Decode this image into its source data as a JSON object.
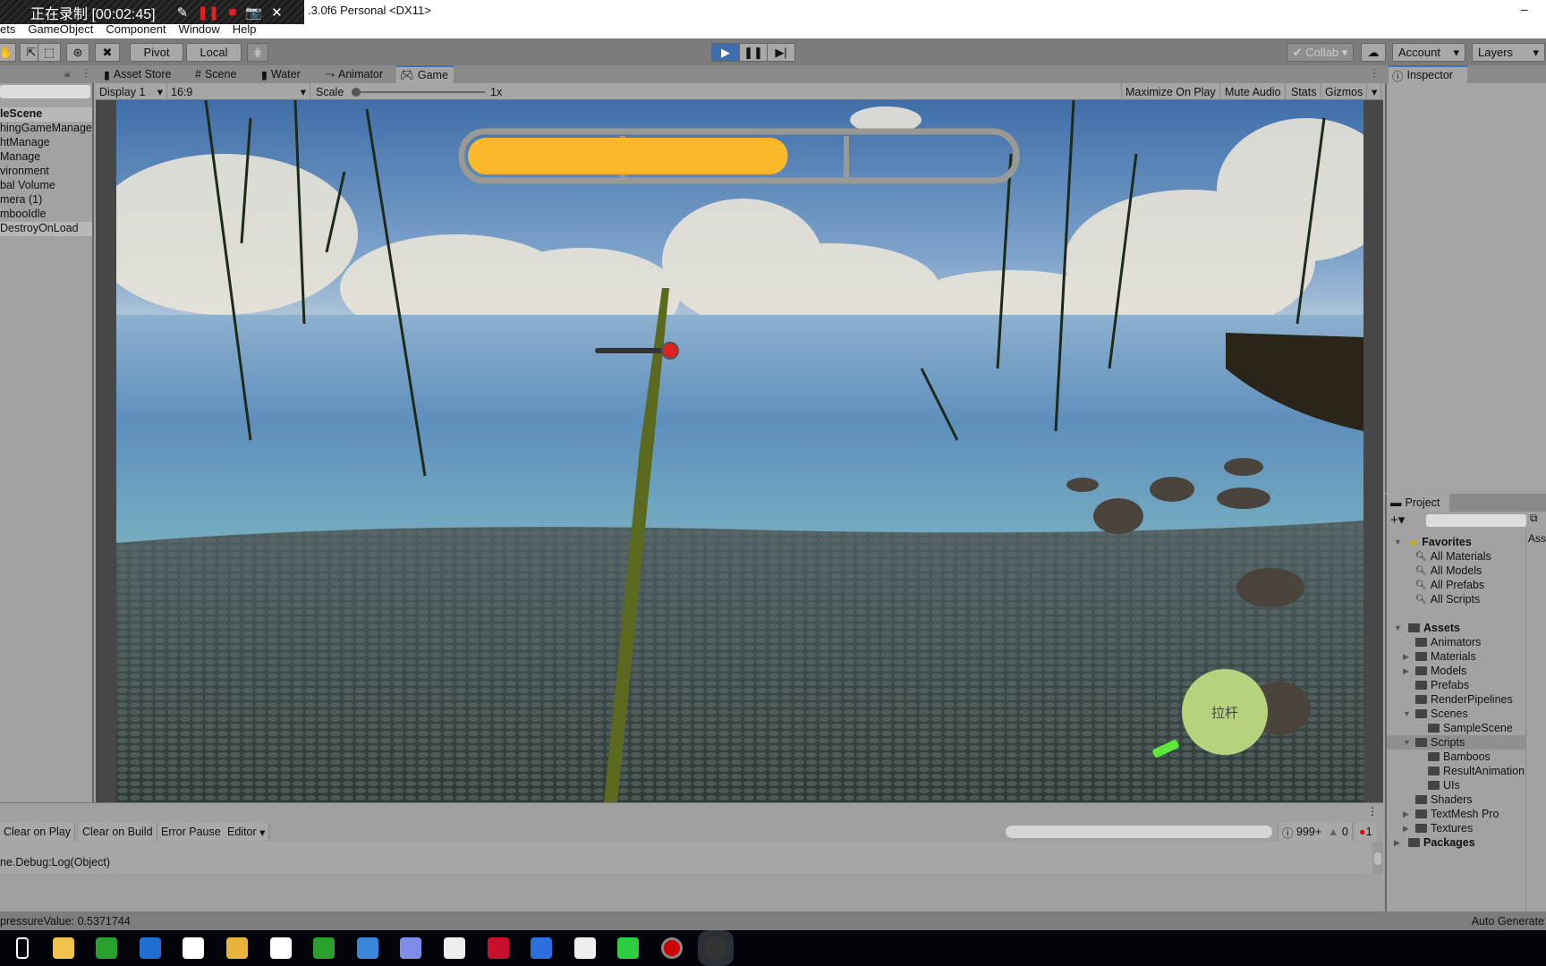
{
  "recorder": {
    "label": "正在录制 [00:02:45]",
    "icons": [
      "pen-icon",
      "pause-icon",
      "stop-icon",
      "camera-icon",
      "close-icon"
    ]
  },
  "window": {
    "title": ".3.0f6 Personal <DX11>",
    "minimize": "–"
  },
  "menu": [
    "ets",
    "GameObject",
    "Component",
    "Window",
    "Help"
  ],
  "toolbar": {
    "pivot": "Pivot",
    "local": "Local",
    "collab": "Collab",
    "account": "Account",
    "layers": "Layers"
  },
  "tabs": [
    "Asset Store",
    "Scene",
    "Water",
    "Animator",
    "Game"
  ],
  "inspector": {
    "tab": "Inspector"
  },
  "gamebar": {
    "display": "Display 1",
    "aspect": "16:9",
    "scale_label": "Scale",
    "scale_value": "1x",
    "scale": 0,
    "maximize": "Maximize On Play",
    "mute": "Mute Audio",
    "stats": "Stats",
    "gizmos": "Gizmos"
  },
  "hierarchy": {
    "items": [
      "leScene",
      "hingGameManage",
      "htManage",
      "Manage",
      "vironment",
      "bal Volume",
      "mera (1)",
      "mbooIdle",
      "DestroyOnLoad"
    ]
  },
  "game": {
    "progress": 0.59,
    "progress_color": "#fbb829",
    "pull_button": "拉杆",
    "pull_color": "#b7d27c"
  },
  "project": {
    "tab": "Project",
    "right_col": "Ass",
    "tree": [
      {
        "label": "Favorites",
        "level": 0,
        "type": "star",
        "bold": true,
        "arrow": "▼"
      },
      {
        "label": "All Materials",
        "level": 1,
        "type": "search"
      },
      {
        "label": "All Models",
        "level": 1,
        "type": "search"
      },
      {
        "label": "All Prefabs",
        "level": 1,
        "type": "search"
      },
      {
        "label": "All Scripts",
        "level": 1,
        "type": "search"
      },
      {
        "label": "",
        "level": 1,
        "type": "gap"
      },
      {
        "label": "Assets",
        "level": 0,
        "type": "folder-open",
        "bold": true,
        "arrow": "▼"
      },
      {
        "label": "Animators",
        "level": 1,
        "type": "folder"
      },
      {
        "label": "Materials",
        "level": 1,
        "type": "folder",
        "arrow": "▶"
      },
      {
        "label": "Models",
        "level": 1,
        "type": "folder",
        "arrow": "▶"
      },
      {
        "label": "Prefabs",
        "level": 1,
        "type": "folder"
      },
      {
        "label": "RenderPipelines",
        "level": 1,
        "type": "folder"
      },
      {
        "label": "Scenes",
        "level": 1,
        "type": "folder-open",
        "arrow": "▼"
      },
      {
        "label": "SampleScene",
        "level": 2,
        "type": "folder"
      },
      {
        "label": "Scripts",
        "level": 1,
        "type": "folder-open",
        "arrow": "▼",
        "selected": true
      },
      {
        "label": "Bamboos",
        "level": 2,
        "type": "folder"
      },
      {
        "label": "ResultAnimation",
        "level": 2,
        "type": "folder"
      },
      {
        "label": "UIs",
        "level": 2,
        "type": "folder"
      },
      {
        "label": "Shaders",
        "level": 1,
        "type": "folder"
      },
      {
        "label": "TextMesh Pro",
        "level": 1,
        "type": "folder",
        "arrow": "▶"
      },
      {
        "label": "Textures",
        "level": 1,
        "type": "folder",
        "arrow": "▶"
      },
      {
        "label": "Packages",
        "level": 0,
        "type": "folder",
        "bold": true,
        "arrow": "▶"
      }
    ]
  },
  "console": {
    "clear_on_play": "Clear on Play",
    "clear_on_build": "Clear on Build",
    "error_pause": "Error Pause",
    "editor": "Editor",
    "log_count": "999+",
    "warn_count": "0",
    "error_count": "1",
    "log_line": "ne.Debug:Log(Object)"
  },
  "status": {
    "message": "pressureValue: 0.5371744",
    "right": "Auto Generate"
  },
  "taskbar": {
    "icons": [
      "task-view-icon",
      "file-explorer-icon",
      "green-app-icon",
      "edge-icon",
      "store-icon",
      "chrome-icon",
      "mail-icon",
      "green-app-2-icon",
      "sogou-icon",
      "feishu-icon",
      "app-circle-icon",
      "netease-music-icon",
      "wps-icon",
      "baidu-netdisk-icon",
      "wechat-icon",
      "recorder-icon",
      "unity-icon"
    ]
  }
}
